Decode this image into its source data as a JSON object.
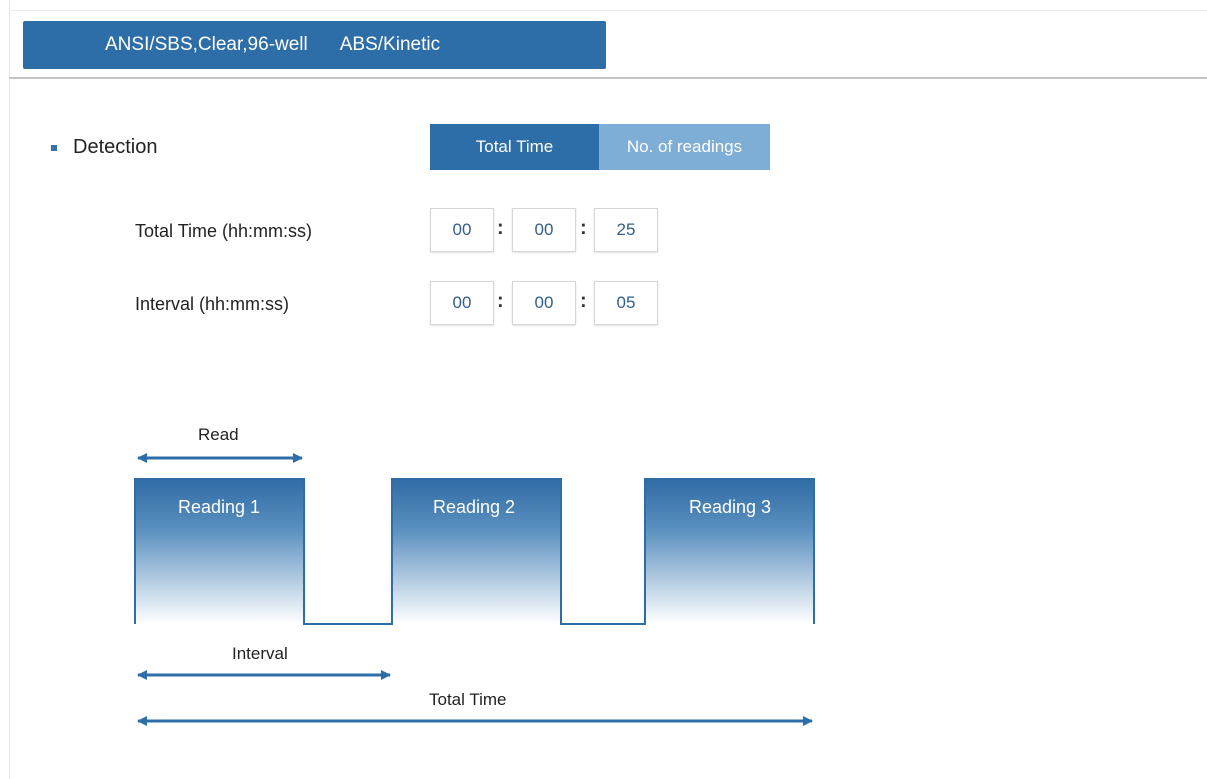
{
  "header": {
    "plate_type": "ANSI/SBS,Clear,96-well",
    "mode": "ABS/Kinetic"
  },
  "section": {
    "title": "Detection"
  },
  "segment": {
    "total_time": "Total Time",
    "no_of_readings": "No. of readings",
    "selected": "Total Time"
  },
  "fields": {
    "total_time": {
      "label": "Total Time (hh:mm:ss)",
      "hh": "00",
      "mm": "00",
      "ss": "25"
    },
    "interval": {
      "label": "Interval (hh:mm:ss)",
      "hh": "00",
      "mm": "00",
      "ss": "05"
    },
    "separator": ":"
  },
  "diagram": {
    "read_label": "Read",
    "interval_label": "Interval",
    "total_time_label": "Total Time",
    "readings": [
      "Reading 1",
      "Reading 2",
      "Reading 3"
    ]
  },
  "colors": {
    "primary": "#2d6da8",
    "secondary": "#7eadd6",
    "text_value": "#2f5f8c"
  }
}
